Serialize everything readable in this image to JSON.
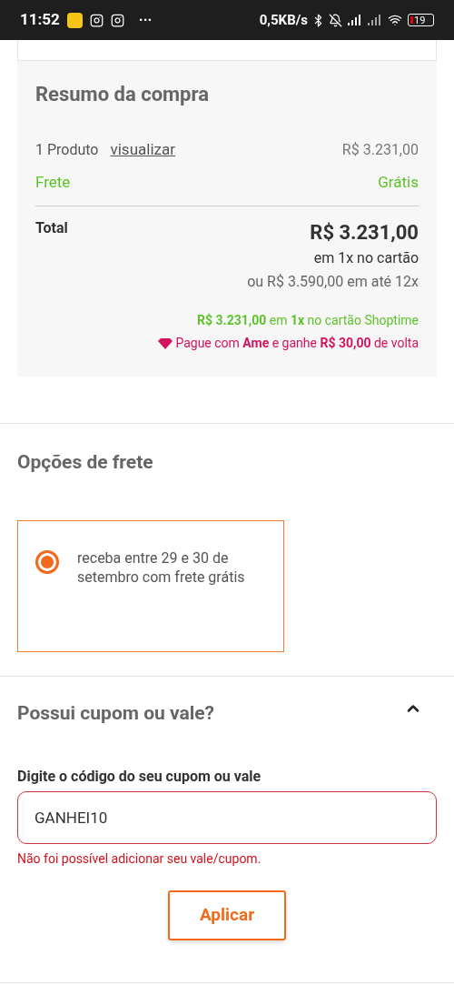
{
  "status_bar": {
    "time": "11:52",
    "more": "···",
    "net_speed": "0,5KB/s",
    "battery": "19"
  },
  "summary": {
    "title": "Resumo da compra",
    "products": {
      "label": "1 Produto",
      "link": "visualizar",
      "value": "R$ 3.231,00"
    },
    "shipping": {
      "label": "Frete",
      "value": "Grátis"
    },
    "total": {
      "label": "Total",
      "value": "R$ 3.231,00",
      "terms": "em 1x no cartão",
      "installments": "ou R$ 3.590,00 em até 12x"
    },
    "promo_card": "**R$ 3.231,00** em **1x** no cartão Shoptime",
    "promo_ame": "Pague com **Ame** e ganhe **R$ 30,00** de volta"
  },
  "shipping_options": {
    "title": "Opções de frete",
    "options": [
      {
        "label": "receba entre 29 e 30 de setembro com frete grátis",
        "selected": true
      }
    ]
  },
  "coupon": {
    "title": "Possui cupom ou vale?",
    "expanded": true,
    "field_label": "Digite o código do seu cupom ou vale",
    "value": "GANHEI10",
    "error": "Não foi possível adicionar seu vale/cupom.",
    "button": "Aplicar"
  }
}
